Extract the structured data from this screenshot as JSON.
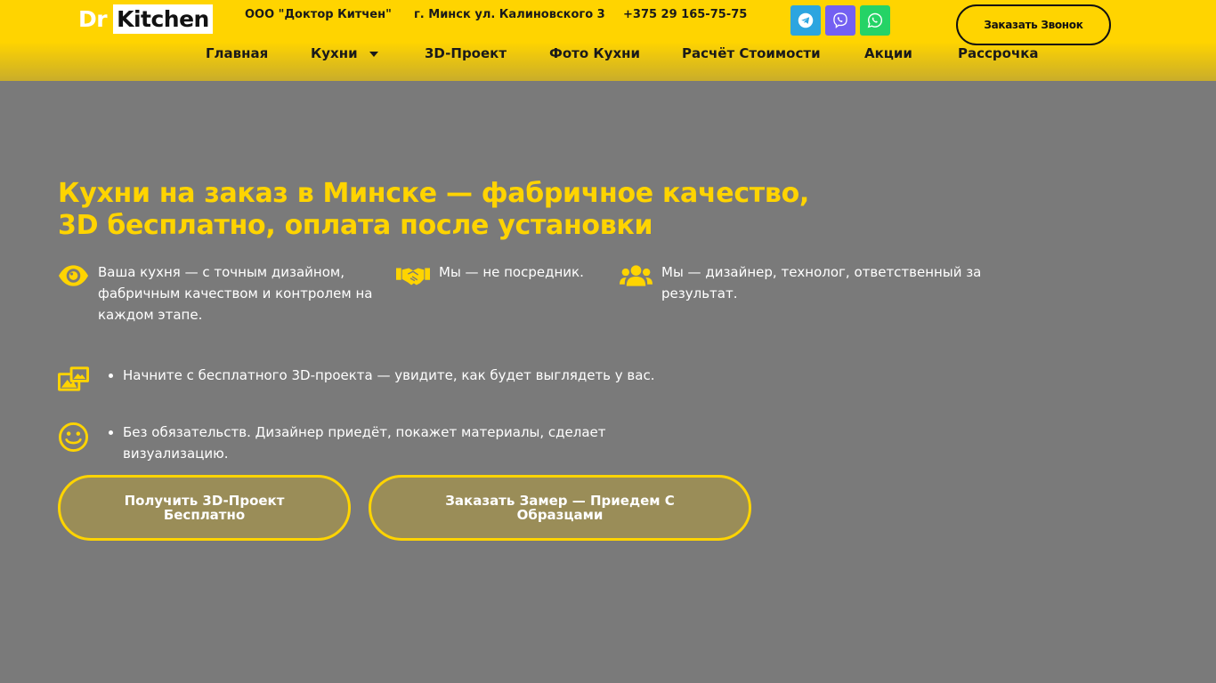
{
  "header": {
    "logo_dr": "Dr",
    "logo_kitchen": "Kitchen",
    "company": "ООО \"Доктор Китчен\"",
    "address": "г. Минск ул. Калиновского 3",
    "phone": "+375 29 165-75-75",
    "call_button": "Заказать Звонок",
    "socials": [
      {
        "name": "telegram",
        "color": "#2ca5e0"
      },
      {
        "name": "viber",
        "color": "#7360f2"
      },
      {
        "name": "whatsapp",
        "color": "#25d366"
      }
    ]
  },
  "nav": {
    "items": [
      {
        "label": "Главная"
      },
      {
        "label": "Кухни",
        "has_dropdown": true
      },
      {
        "label": "3D-Проект"
      },
      {
        "label": "Фото Кухни"
      },
      {
        "label": "Расчёт Стоимости"
      },
      {
        "label": "Акции"
      },
      {
        "label": "Рассрочка"
      }
    ]
  },
  "hero": {
    "title_line1": "Кухни на заказ в Минске — фабричное качество,",
    "title_line2": "3D бесплатно, оплата после установки",
    "features": [
      {
        "icon": "eye-icon",
        "text": "Ваша кухня — с точным дизайном, фабричным качеством и контролем на каждом этапе."
      },
      {
        "icon": "handshake-icon",
        "text": "Мы — не посредник."
      },
      {
        "icon": "users-icon",
        "text": "Мы — дизайнер, технолог, ответственный за результат."
      }
    ],
    "bullets": [
      {
        "icon": "images-icon",
        "text": "Начните с бесплатного 3D-проекта — увидите, как будет выглядеть у вас."
      },
      {
        "icon": "smile-icon",
        "text": "Без обязательств. Дизайнер приедёт, покажет материалы, сделает визуализацию."
      }
    ],
    "cta_primary": "Получить 3D-Проект Бесплатно",
    "cta_secondary": "Заказать Замер — Приедем С Образцами"
  },
  "colors": {
    "accent": "#ffd400",
    "background": "#7a7a7a",
    "button_fill": "#9a8d58"
  }
}
